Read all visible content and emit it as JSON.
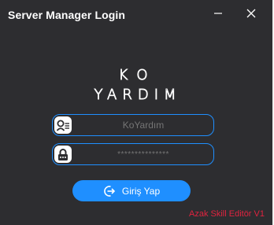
{
  "window": {
    "title": "Server Manager Login"
  },
  "logo": {
    "line1": "KO",
    "line2": "YARDIM"
  },
  "username": {
    "value": "",
    "placeholder": "KoYardım"
  },
  "password": {
    "value": "",
    "placeholder": "***************"
  },
  "login_button": {
    "label": "Giriş Yap",
    "icon": "login-arrow-icon"
  },
  "footer": {
    "version": "Azak Skill Editör V1"
  },
  "icons": {
    "minimize": "minimize-icon",
    "close": "close-icon",
    "user": "user-list-icon",
    "lock": "lock-icon"
  },
  "colors": {
    "background": "#2d2d30",
    "accent": "#1f8fff",
    "version_text": "#e0233f",
    "placeholder_text": "#8f8f8f"
  }
}
